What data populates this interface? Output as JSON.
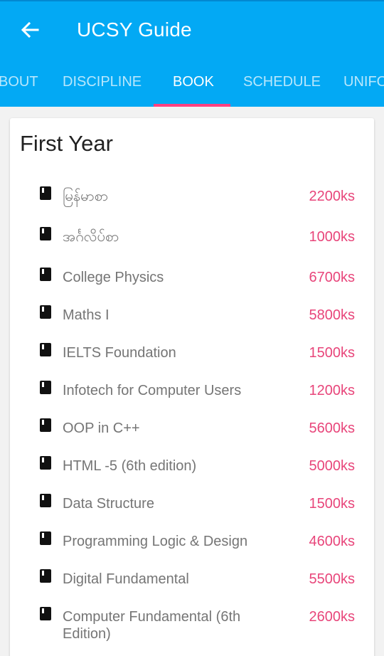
{
  "app_bar": {
    "title": "UCSY Guide",
    "back_icon": "arrow-left-icon",
    "color": "#03a9f4"
  },
  "tabs": [
    {
      "label": "BOUT",
      "active": false
    },
    {
      "label": "DISCIPLINE",
      "active": false
    },
    {
      "label": "BOOK",
      "active": true
    },
    {
      "label": "SCHEDULE",
      "active": false
    },
    {
      "label": "UNIFO",
      "active": false
    }
  ],
  "indicator_color": "#ff4081",
  "section": {
    "title": "First Year",
    "books": [
      {
        "name": "မြန်မာစာ",
        "price": "2200ks"
      },
      {
        "name": "အင်္ဂလိပ်စာ",
        "price": "1000ks"
      },
      {
        "name": "College Physics",
        "price": "6700ks"
      },
      {
        "name": "Maths I",
        "price": "5800ks"
      },
      {
        "name": "IELTS Foundation",
        "price": "1500ks"
      },
      {
        "name": "Infotech for Computer Users",
        "price": "1200ks"
      },
      {
        "name": "OOP in C++",
        "price": "5600ks"
      },
      {
        "name": "HTML -5 (6th edition)",
        "price": "5000ks"
      },
      {
        "name": "Data Structure",
        "price": "1500ks"
      },
      {
        "name": "Programming Logic & Design",
        "price": "4600ks"
      },
      {
        "name": "Digital Fundamental",
        "price": "5500ks"
      },
      {
        "name": "Computer Fundamental (6th Edition)",
        "price": "2600ks"
      }
    ],
    "item_icon": "book-icon",
    "price_color": "#e8457a"
  }
}
